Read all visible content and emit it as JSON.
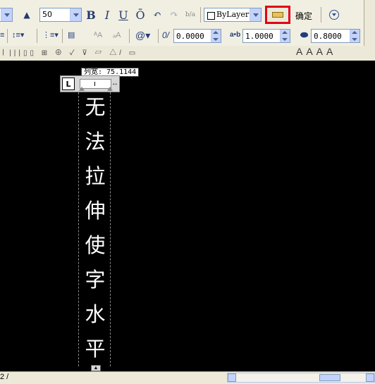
{
  "toolbar": {
    "font_size_value": "50",
    "bold_label": "B",
    "italic_label": "I",
    "underline_label": "U",
    "overline_label": "Ō",
    "undo_icon": "undo-icon",
    "redo_icon": "redo-icon",
    "stack_label": "b/a",
    "color_value": "ByLayer",
    "ok_label": "确定",
    "obliquing_value": "0.0000",
    "tracking_value": "1.0000",
    "width_factor_value": "0.8000",
    "at_symbol": "@"
  },
  "ruler": {
    "tab_label": "L",
    "column_width_tip": "列宽: 75.1144"
  },
  "editor": {
    "chars": [
      "无",
      "法",
      "拉",
      "伸",
      "使",
      "字",
      "水",
      "平"
    ]
  },
  "statusbar": {
    "left_text": "2 /"
  },
  "colors": {
    "highlight": "#e0001a",
    "canvas": "#000000",
    "text": "#ffffff"
  }
}
